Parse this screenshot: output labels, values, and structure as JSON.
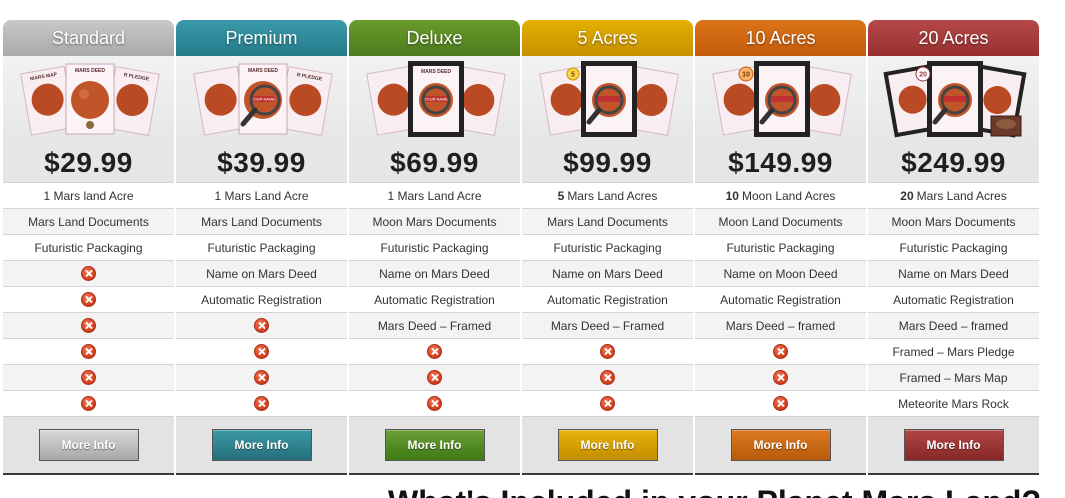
{
  "colors": {
    "standard": "#bdbdbd",
    "premium": "#2f8a98",
    "deluxe": "#5a8a23",
    "five_acres": "#d8a000",
    "ten_acres": "#cf6712",
    "twenty_acres": "#a93a3a"
  },
  "icons": {
    "unavailable": "x-circle-icon"
  },
  "plans": [
    {
      "name": "Standard",
      "price": "$29.99",
      "features": [
        {
          "qty": "",
          "text": "1 Mars land Acre"
        },
        {
          "qty": "",
          "text": "Mars Land Documents"
        },
        {
          "qty": "",
          "text": "Futuristic Packaging"
        },
        {
          "qty": "",
          "text": ""
        },
        {
          "qty": "",
          "text": ""
        },
        {
          "qty": "",
          "text": ""
        },
        {
          "qty": "",
          "text": ""
        },
        {
          "qty": "",
          "text": ""
        },
        {
          "qty": "",
          "text": ""
        }
      ],
      "button": "More Info"
    },
    {
      "name": "Premium",
      "price": "$39.99",
      "features": [
        {
          "qty": "",
          "text": "1 Mars Land Acre"
        },
        {
          "qty": "",
          "text": "Mars Land Documents"
        },
        {
          "qty": "",
          "text": "Futuristic Packaging"
        },
        {
          "qty": "",
          "text": "Name on Mars Deed"
        },
        {
          "qty": "",
          "text": "Automatic Registration"
        },
        {
          "qty": "",
          "text": ""
        },
        {
          "qty": "",
          "text": ""
        },
        {
          "qty": "",
          "text": ""
        },
        {
          "qty": "",
          "text": ""
        }
      ],
      "button": "More Info"
    },
    {
      "name": "Deluxe",
      "price": "$69.99",
      "features": [
        {
          "qty": "",
          "text": "1 Mars Land Acre"
        },
        {
          "qty": "",
          "text": "Moon Mars Documents"
        },
        {
          "qty": "",
          "text": "Futuristic Packaging"
        },
        {
          "qty": "",
          "text": "Name on Mars Deed"
        },
        {
          "qty": "",
          "text": "Automatic Registration"
        },
        {
          "qty": "",
          "text": "Mars Deed – Framed"
        },
        {
          "qty": "",
          "text": ""
        },
        {
          "qty": "",
          "text": ""
        },
        {
          "qty": "",
          "text": ""
        }
      ],
      "button": "More Info"
    },
    {
      "name": "5 Acres",
      "price": "$99.99",
      "features": [
        {
          "qty": "5",
          "text": "Mars Land Acres"
        },
        {
          "qty": "",
          "text": "Mars Land Documents"
        },
        {
          "qty": "",
          "text": "Futuristic Packaging"
        },
        {
          "qty": "",
          "text": "Name on Mars Deed"
        },
        {
          "qty": "",
          "text": "Automatic Registration"
        },
        {
          "qty": "",
          "text": "Mars Deed – Framed"
        },
        {
          "qty": "",
          "text": ""
        },
        {
          "qty": "",
          "text": ""
        },
        {
          "qty": "",
          "text": ""
        }
      ],
      "button": "More Info"
    },
    {
      "name": "10 Acres",
      "price": "$149.99",
      "features": [
        {
          "qty": "10",
          "text": "Moon Land Acres"
        },
        {
          "qty": "",
          "text": "Moon Land Documents"
        },
        {
          "qty": "",
          "text": "Futuristic Packaging"
        },
        {
          "qty": "",
          "text": "Name on Moon Deed"
        },
        {
          "qty": "",
          "text": "Automatic Registration"
        },
        {
          "qty": "",
          "text": "Mars Deed – framed"
        },
        {
          "qty": "",
          "text": ""
        },
        {
          "qty": "",
          "text": ""
        },
        {
          "qty": "",
          "text": ""
        }
      ],
      "button": "More Info"
    },
    {
      "name": "20 Acres",
      "price": "$249.99",
      "features": [
        {
          "qty": "20",
          "text": "Mars Land Acres"
        },
        {
          "qty": "",
          "text": "Moon Mars Documents"
        },
        {
          "qty": "",
          "text": "Futuristic Packaging"
        },
        {
          "qty": "",
          "text": "Name on Mars Deed"
        },
        {
          "qty": "",
          "text": "Automatic Registration"
        },
        {
          "qty": "",
          "text": "Mars Deed – framed"
        },
        {
          "qty": "",
          "text": "Framed – Mars Pledge"
        },
        {
          "qty": "",
          "text": "Framed – Mars Map"
        },
        {
          "qty": "",
          "text": "Meteorite Mars Rock"
        }
      ],
      "button": "More Info"
    }
  ],
  "image_text": {
    "mars_deed": "MARS DEED",
    "mars_map": "MARS MAP",
    "pledge": "R PLEDGE",
    "your_name": "YOUR NAME"
  },
  "bottom_heading": "What's Included in your Planet Mars Land?"
}
